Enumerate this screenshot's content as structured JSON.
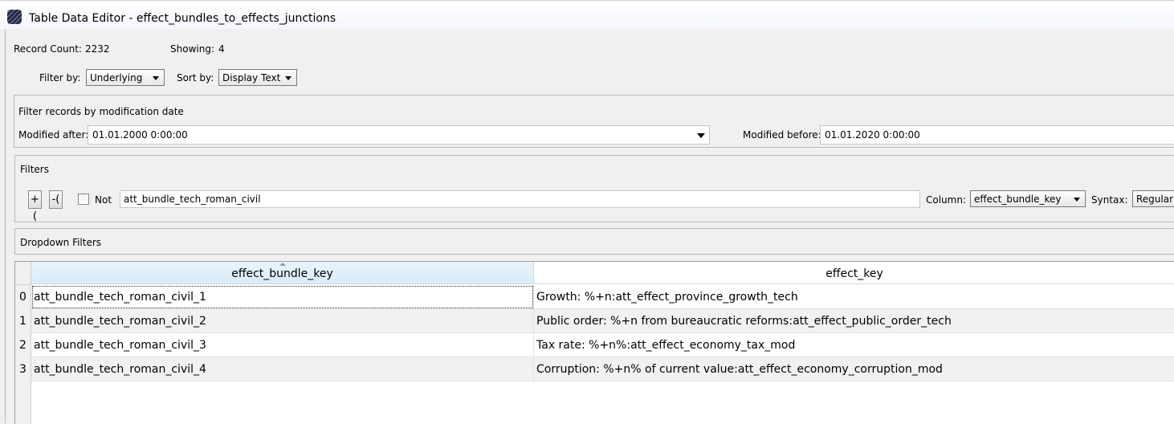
{
  "window": {
    "title": "Table Data Editor - effect_bundles_to_effects_junctions",
    "icon": "app-icon"
  },
  "summary": {
    "record_count_label": "Record Count:",
    "record_count": "2232",
    "showing_label": "Showing:",
    "showing": "4"
  },
  "filter_by": {
    "label": "Filter by:",
    "value": "Underlying"
  },
  "sort_by": {
    "label": "Sort by:",
    "value": "Display Text"
  },
  "date_filter": {
    "title": "Filter records by modification date",
    "after_label": "Modified after:",
    "after_value": "01.01.2000 0:00:00",
    "before_label": "Modified before:",
    "before_value": "01.01.2020 0:00:00"
  },
  "filters": {
    "title": "Filters",
    "add_label": "+(",
    "remove_label": "-(",
    "not_label": "Not",
    "not_checked": false,
    "query": "att_bundle_tech_roman_civil",
    "column_label": "Column:",
    "column_value": "effect_bundle_key",
    "syntax_label": "Syntax:",
    "syntax_value": "Regular e"
  },
  "dropdown_filters": {
    "title": "Dropdown Filters"
  },
  "table": {
    "columns": [
      "effect_bundle_key",
      "effect_key"
    ],
    "sorted_column": "effect_bundle_key",
    "rows": [
      {
        "index": "0",
        "effect_bundle_key": "att_bundle_tech_roman_civil_1",
        "effect_key": "Growth: %+n:att_effect_province_growth_tech"
      },
      {
        "index": "1",
        "effect_bundle_key": "att_bundle_tech_roman_civil_2",
        "effect_key": "Public order: %+n from bureaucratic reforms:att_effect_public_order_tech"
      },
      {
        "index": "2",
        "effect_bundle_key": "att_bundle_tech_roman_civil_3",
        "effect_key": "Tax rate: %+n%:att_effect_economy_tax_mod"
      },
      {
        "index": "3",
        "effect_bundle_key": "att_bundle_tech_roman_civil_4",
        "effect_key": "Corruption: %+n% of current value:att_effect_economy_corruption_mod"
      }
    ]
  }
}
